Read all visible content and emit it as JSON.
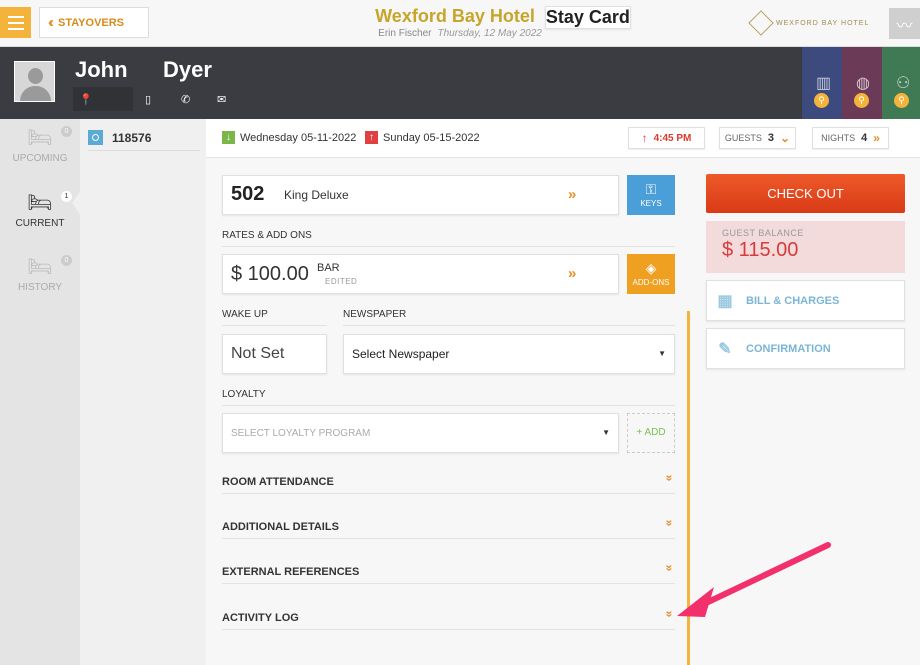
{
  "header": {
    "back_label": "STAYOVERS",
    "hotel_name": "Wexford Bay Hotel",
    "page_title": "Stay Card",
    "user_name": "Erin Fischer",
    "date": "Thursday, 12 May 2022",
    "brand": "WEXFORD BAY HOTEL"
  },
  "guest": {
    "first_name": "John",
    "last_name": "Dyer"
  },
  "rail": {
    "items": [
      {
        "label": "UPCOMING",
        "count": "0"
      },
      {
        "label": "CURRENT",
        "count": "1"
      },
      {
        "label": "HISTORY",
        "count": "0"
      }
    ]
  },
  "reservation": {
    "number": "118576"
  },
  "dates": {
    "arrival": "Wednesday 05-11-2022",
    "departure": "Sunday 05-15-2022",
    "time": "4:45 PM",
    "guests_label": "GUESTS",
    "guests": "3",
    "nights_label": "NIGHTS",
    "nights": "4"
  },
  "room": {
    "number": "502",
    "type": "King Deluxe",
    "keys_label": "KEYS"
  },
  "rates": {
    "section_label": "RATES & ADD ONS",
    "amount": "$ 100.00",
    "code": "BAR",
    "edited": "EDITED",
    "addons_label": "ADD-ONS"
  },
  "wakeup": {
    "label": "WAKE UP",
    "value": "Not Set"
  },
  "newspaper": {
    "label": "NEWSPAPER",
    "value": "Select Newspaper"
  },
  "loyalty": {
    "label": "LOYALTY",
    "placeholder": "SELECT LOYALTY PROGRAM",
    "add_label": "+ ADD"
  },
  "sections": [
    {
      "label": "ROOM ATTENDANCE"
    },
    {
      "label": "ADDITIONAL DETAILS"
    },
    {
      "label": "EXTERNAL REFERENCES"
    },
    {
      "label": "ACTIVITY LOG"
    }
  ],
  "sidebar": {
    "checkout_label": "CHECK OUT",
    "balance_label": "GUEST BALANCE",
    "balance_value": "$ 115.00",
    "bill_label": "BILL & CHARGES",
    "confirmation_label": "CONFIRMATION"
  },
  "colors": {
    "accent": "#f4b33b",
    "checkout": "#e24a1f",
    "balance_text": "#d83b3b",
    "link_blue": "#7bb5d6",
    "annotation_arrow": "#f2306b"
  }
}
